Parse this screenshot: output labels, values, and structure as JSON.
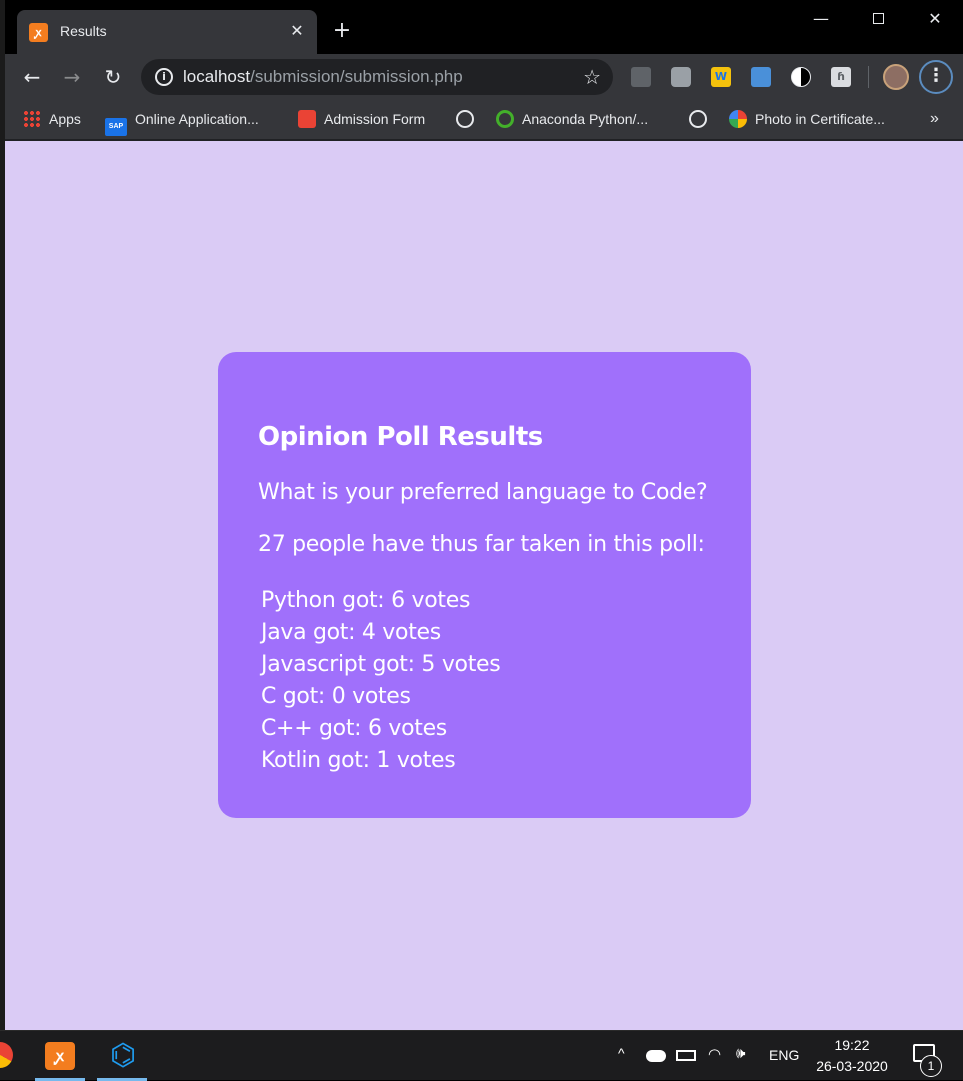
{
  "browser": {
    "tab": {
      "favicon": "xampp-icon",
      "title": "Results",
      "close": "✕"
    },
    "new_tab": "+",
    "window_controls": {
      "minimize": "—",
      "close": "✕"
    },
    "toolbar": {
      "back": "←",
      "forward": "→",
      "reload": "↻",
      "info": "i",
      "url_host": "localhost",
      "url_path": "/submission/submission.php",
      "star": "☆",
      "menu": "⋮"
    },
    "extensions": [
      "bulb-icon",
      "camera-icon",
      "w-icon",
      "window-icon",
      "contrast-icon",
      "h-icon"
    ],
    "ext_labels": {
      "w": "W",
      "h": "ɦ"
    },
    "bookmarks": [
      {
        "label": "Apps",
        "icon": "apps-grid-icon"
      },
      {
        "label": "Online Application...",
        "icon": "sap-icon",
        "icon_text": "SAP"
      },
      {
        "label": "Admission Form",
        "icon": "admission-icon"
      },
      {
        "label": "",
        "icon": "globe-icon"
      },
      {
        "label": "Anaconda Python/...",
        "icon": "anaconda-icon"
      },
      {
        "label": "",
        "icon": "globe-icon"
      },
      {
        "label": "Photo in Certificate...",
        "icon": "photo-icon"
      }
    ],
    "bookmarks_more": "»"
  },
  "page": {
    "title": "Opinion Poll Results",
    "question": "What is your preferred language to Code?",
    "count_text": "27 people have thus far taken in this poll:",
    "results": [
      "Python got: 6 votes",
      "Java got: 4 votes",
      "Javascript got: 5 votes",
      "C got: 0 votes",
      "C++ got: 6 votes",
      "Kotlin got: 1 votes"
    ],
    "colors": {
      "background": "#dacbf5",
      "card": "#a070fb",
      "text": "#ffffff"
    }
  },
  "taskbar": {
    "apps": [
      "chrome-icon",
      "xampp-icon",
      "vscode-icon"
    ],
    "xampp_glyph": "ꭙ",
    "vscode_glyph": "⌬",
    "tray_up": "^",
    "wifi": "◠",
    "volume": "🕪",
    "language": "ENG",
    "time": "19:22",
    "date": "26-03-2020",
    "notifications": "1"
  }
}
